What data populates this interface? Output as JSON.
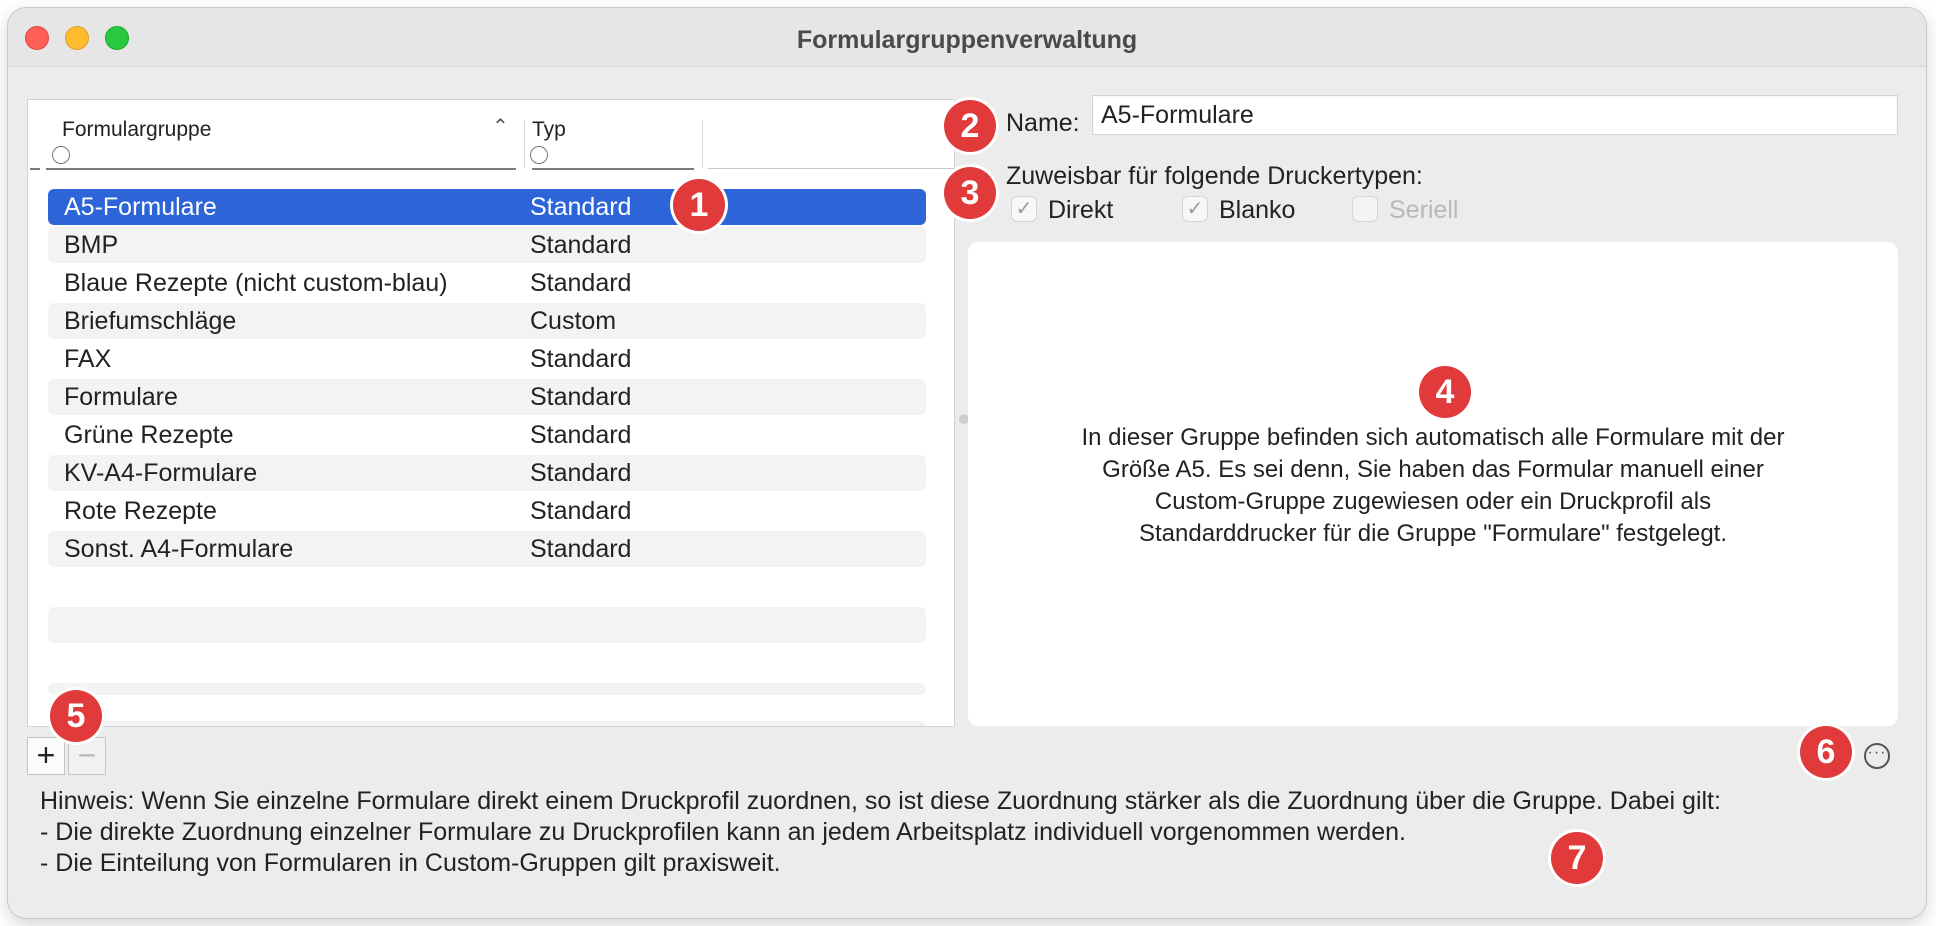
{
  "window": {
    "title": "Formulargruppenverwaltung"
  },
  "table": {
    "columns": [
      {
        "label": "Formulargruppe",
        "sort": "ascending"
      },
      {
        "label": "Typ"
      },
      {
        "label": ""
      }
    ],
    "rows": [
      {
        "name": "A5-Formulare",
        "type": "Standard",
        "selected": true
      },
      {
        "name": "BMP",
        "type": "Standard"
      },
      {
        "name": "Blaue Rezepte (nicht custom-blau)",
        "type": "Standard"
      },
      {
        "name": "Briefumschläge",
        "type": "Custom"
      },
      {
        "name": "FAX",
        "type": "Standard"
      },
      {
        "name": "Formulare",
        "type": "Standard"
      },
      {
        "name": "Grüne Rezepte",
        "type": "Standard"
      },
      {
        "name": "KV-A4-Formulare",
        "type": "Standard"
      },
      {
        "name": "Rote Rezepte",
        "type": "Standard"
      },
      {
        "name": "Sonst. A4-Formulare",
        "type": "Standard"
      }
    ],
    "add_label": "+",
    "remove_label": "−"
  },
  "detail": {
    "name_label": "Name:",
    "name_value": "A5-Formulare",
    "printer_types_label": "Zuweisbar für folgende Druckertypen:",
    "checkboxes": [
      {
        "label": "Direkt",
        "checked": true,
        "enabled": true
      },
      {
        "label": "Blanko",
        "checked": true,
        "enabled": true
      },
      {
        "label": "Seriell",
        "checked": false,
        "enabled": false
      }
    ],
    "description_lines": [
      "In dieser Gruppe befinden sich automatisch alle Formulare mit der",
      "Größe A5. Es sei denn, Sie haben das Formular manuell einer",
      "Custom-Gruppe zugewiesen oder ein Druckprofil als",
      "Standarddrucker für die Gruppe \"Formulare\" festgelegt."
    ]
  },
  "note": {
    "lines": [
      "Hinweis: Wenn Sie einzelne Formulare direkt einem Druckprofil zuordnen, so ist diese Zuordnung stärker als die Zuordnung über die Gruppe. Dabei gilt:",
      "- Die direkte Zuordnung einzelner Formulare zu Druckprofilen kann an jedem Arbeitsplatz individuell vorgenommen werden.",
      "- Die Einteilung von Formularen in Custom-Gruppen gilt praxisweit."
    ]
  },
  "icons": {
    "sort": "chevron-up-icon",
    "more": "ellipsis-circle-icon",
    "check": "checkmark-icon"
  },
  "badges": [
    "1",
    "2",
    "3",
    "4",
    "5",
    "6",
    "7"
  ],
  "colors": {
    "selection": "#2d64d8",
    "badge": "#e03a3a"
  }
}
